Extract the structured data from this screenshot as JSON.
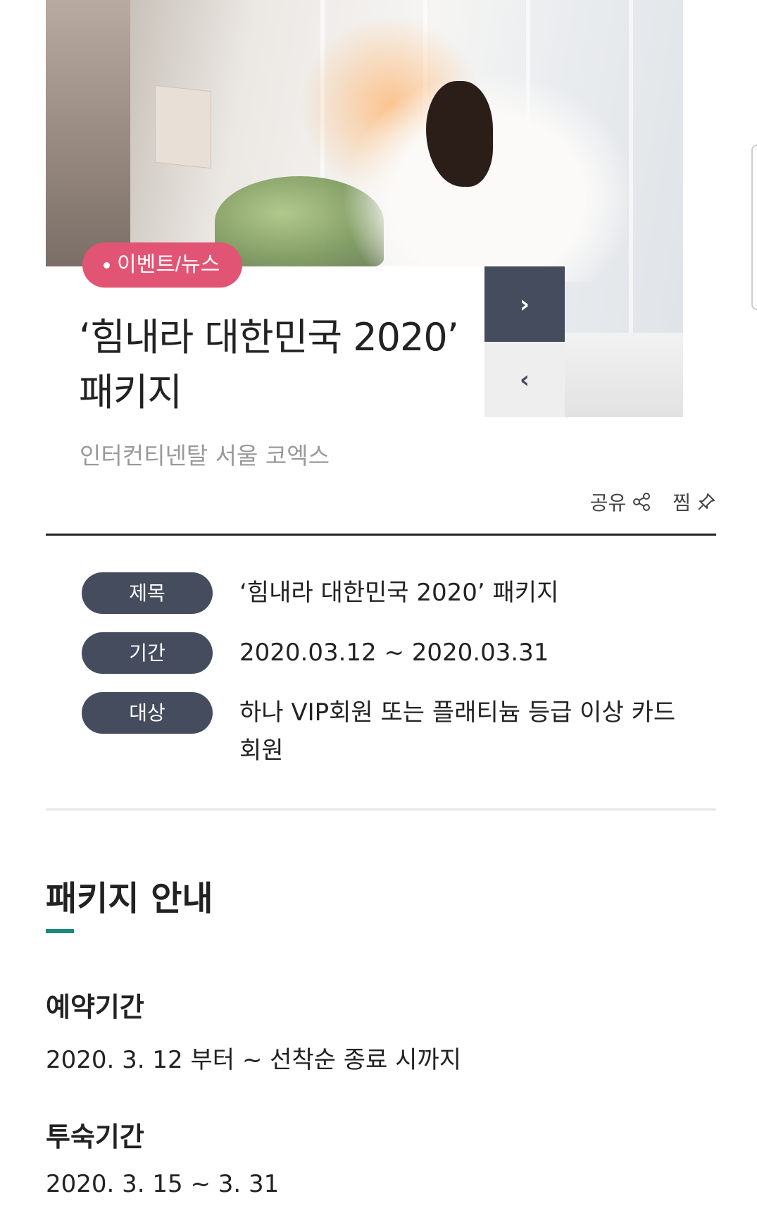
{
  "hero": {
    "badge": "이벤트/뉴스",
    "next_arrow": "›",
    "prev_arrow": "‹"
  },
  "header": {
    "title": "‘힘내라 대한민국 2020’ 패키지",
    "hotel": "인터컨티넨탈 서울 코엑스"
  },
  "actions": {
    "share_label": "공유",
    "save_label": "찜"
  },
  "info": {
    "rows": [
      {
        "label": "제목",
        "value": "‘힘내라 대한민국 2020’ 패키지"
      },
      {
        "label": "기간",
        "value": "2020.03.12 ~ 2020.03.31"
      },
      {
        "label": "대상",
        "value": "하나 VIP회원 또는 플래티늄 등급 이상 카드 회원"
      }
    ]
  },
  "package": {
    "section_title": "패키지 안내",
    "booking_period_heading": "예약기간",
    "booking_period_value": "2020. 3. 12 부터 ~ 선착순 종료 시까지",
    "stay_period_heading": "투숙기간",
    "stay_period_value": "2020. 3. 15 ~ 3. 31"
  },
  "colors": {
    "badge": "#e25474",
    "label_bg": "#454c5e",
    "accent": "#1b8a7a"
  }
}
